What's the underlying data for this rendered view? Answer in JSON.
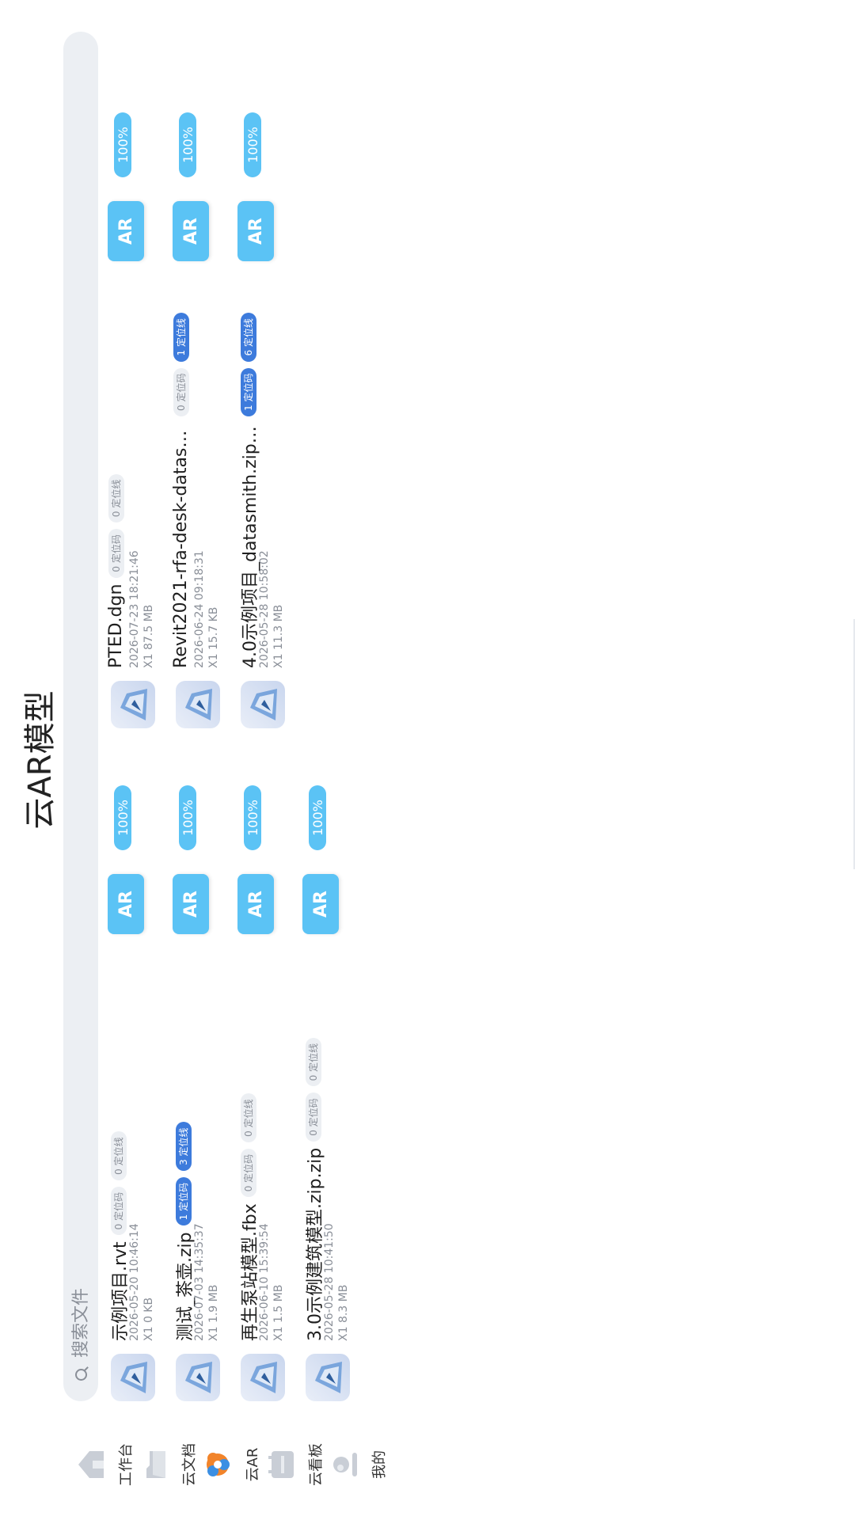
{
  "title": "云AR模型",
  "search": {
    "placeholder": "搜索文件"
  },
  "ar_label": "AR",
  "files": [
    {
      "name": "示例项目.rvt",
      "date": "2026-05-20 10:46:14",
      "size": "X1   0 KB",
      "codes": "0 定位码",
      "lines": "0 定位线",
      "codes_active": false,
      "lines_active": false,
      "progress": "100%"
    },
    {
      "name": "测试_茶壶.zip",
      "date": "2026-07-03 14:35:37",
      "size": "X1  1.9 MB",
      "codes": "1 定位码",
      "lines": "3 定位线",
      "codes_active": true,
      "lines_active": true,
      "progress": "100%"
    },
    {
      "name": "再生泵站模型.fbx",
      "date": "2026-06-10 15:39:54",
      "size": "X1  1.5 MB",
      "codes": "0 定位码",
      "lines": "0 定位线",
      "codes_active": false,
      "lines_active": false,
      "progress": "100%"
    },
    {
      "name": "3.0示例建筑模型.zip.zip",
      "date": "2026-05-28 10:41:50",
      "size": "X1  8.3 MB",
      "codes": "0 定位码",
      "lines": "0 定位线",
      "codes_active": false,
      "lines_active": false,
      "progress": "100%"
    },
    {
      "name": "PTED.dgn",
      "date": "2026-07-23 18:21:46",
      "size": "X1  87.5 MB",
      "codes": "0 定位码",
      "lines": "0 定位线",
      "codes_active": false,
      "lines_active": false,
      "progress": "100%"
    },
    {
      "name": "Revit2021-rfa-desk-datasmith.…",
      "date": "2026-06-24 09:18:31",
      "size": "X1  15.7 KB",
      "codes": "0 定位码",
      "lines": "1 定位线",
      "codes_active": false,
      "lines_active": true,
      "progress": "100%"
    },
    {
      "name": "4.0示例项目_datasmith.zip.zip",
      "date": "2026-05-28 10:58:02",
      "size": "X1  11.3 MB",
      "codes": "1 定位码",
      "lines": "6 定位线",
      "codes_active": true,
      "lines_active": true,
      "progress": "100%"
    }
  ],
  "nav": [
    {
      "label": "工作台",
      "icon": "home-icon"
    },
    {
      "label": "云文档",
      "icon": "folder-icon"
    },
    {
      "label": "云AR",
      "icon": "cloud-ar-icon",
      "active": true
    },
    {
      "label": "云看板",
      "icon": "dashboard-icon"
    },
    {
      "label": "我的",
      "icon": "profile-icon"
    }
  ],
  "colors": {
    "accent": "#5bc3f5",
    "badge_blue": "#3d7bdc",
    "badge_gray": "#eceff3",
    "text_secondary": "#8a8f98"
  }
}
